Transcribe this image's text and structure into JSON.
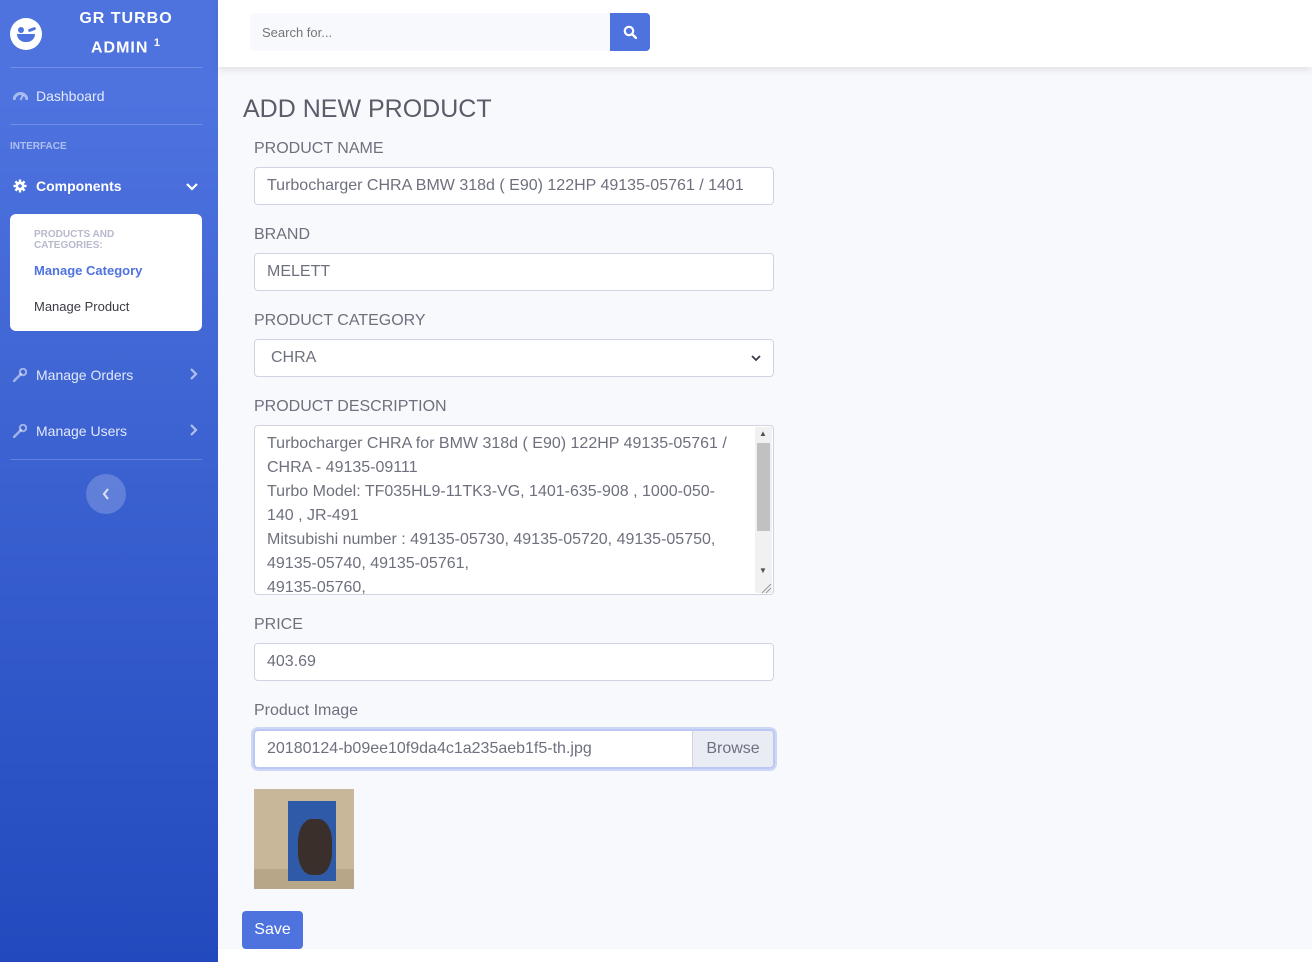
{
  "sidebar": {
    "brand": {
      "line1": "GR TURBO",
      "line2": "ADMIN",
      "sup": "1"
    },
    "dashboard": "Dashboard",
    "heading": "INTERFACE",
    "components": "Components",
    "submenu": {
      "header": "PRODUCTS AND CATEGORIES:",
      "items": [
        "Manage Category",
        "Manage Product"
      ]
    },
    "orders": "Manage Orders",
    "users": "Manage Users"
  },
  "topbar": {
    "search_placeholder": "Search for..."
  },
  "page": {
    "title": "ADD NEW PRODUCT"
  },
  "form": {
    "name_label": "PRODUCT NAME",
    "name_value": "Turbocharger CHRA BMW 318d ( E90) 122HP 49135-05761 / 1401",
    "brand_label": "BRAND",
    "brand_value": "MELETT",
    "category_label": "PRODUCT CATEGORY",
    "category_value": "CHRA",
    "desc_label": "PRODUCT DESCRIPTION",
    "desc_value": "Turbocharger CHRA for BMW 318d ( E90) 122HP 49135-05761 /\nCHRA - 49135-09111\nTurbo Model: TF035HL9-11TK3-VG, 1401-635-908 , 1000-050-\n140 , JR-491\nMitsubishi number : 49135-05730, 49135-05720, 49135-05750,\n49135-05740, 49135-05761,\n49135-05760,",
    "price_label": "PRICE",
    "price_value": "403.69",
    "image_label": "Product Image",
    "image_file": "20180124-b09ee10f9da4c1a235aeb1f5-th.jpg",
    "browse_label": "Browse",
    "save_label": "Save"
  },
  "colors": {
    "primary": "#4e73df",
    "sidebar_end": "#224abe",
    "background": "#f8f9fc"
  }
}
